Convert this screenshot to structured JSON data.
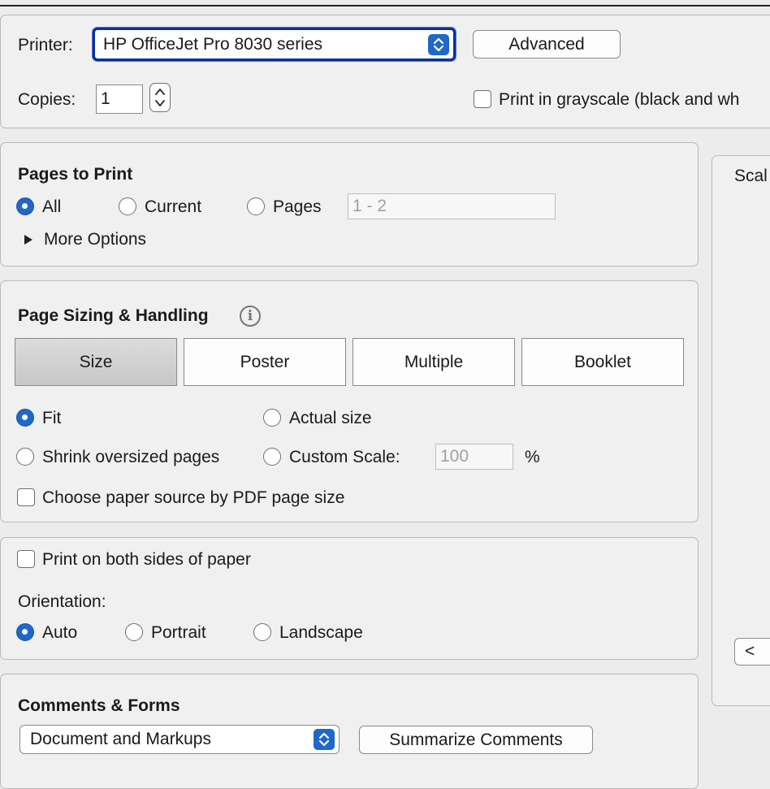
{
  "printer": {
    "label": "Printer:",
    "selected": "HP OfficeJet Pro 8030 series",
    "advanced_label": "Advanced"
  },
  "copies": {
    "label": "Copies:",
    "value": "1"
  },
  "grayscale": {
    "label": "Print in grayscale (black and wh",
    "checked": false
  },
  "pages_to_print": {
    "title": "Pages to Print",
    "all_label": "All",
    "current_label": "Current",
    "pages_label": "Pages",
    "pages_value": "1 - 2",
    "more_options_label": "More Options",
    "selected": "All"
  },
  "page_sizing": {
    "title": "Page Sizing & Handling",
    "tabs": [
      {
        "label": "Size"
      },
      {
        "label": "Poster"
      },
      {
        "label": "Multiple"
      },
      {
        "label": "Booklet"
      }
    ],
    "active_tab": "Size",
    "fit_label": "Fit",
    "actual_label": "Actual size",
    "shrink_label": "Shrink oversized pages",
    "custom_label": "Custom Scale:",
    "custom_value": "100",
    "percent": "%",
    "paper_source_label": "Choose paper source by PDF page size"
  },
  "duplex": {
    "label": "Print on both sides of paper",
    "orientation_label": "Orientation:",
    "auto_label": "Auto",
    "portrait_label": "Portrait",
    "landscape_label": "Landscape"
  },
  "comments_forms": {
    "title": "Comments & Forms",
    "selected": "Document and Markups",
    "summarize_label": "Summarize Comments"
  },
  "preview": {
    "scale_label": "Scal",
    "prev_label": "<"
  },
  "colors": {
    "accent": "#1f67c8",
    "focus_ring": "#0a2f9c"
  }
}
